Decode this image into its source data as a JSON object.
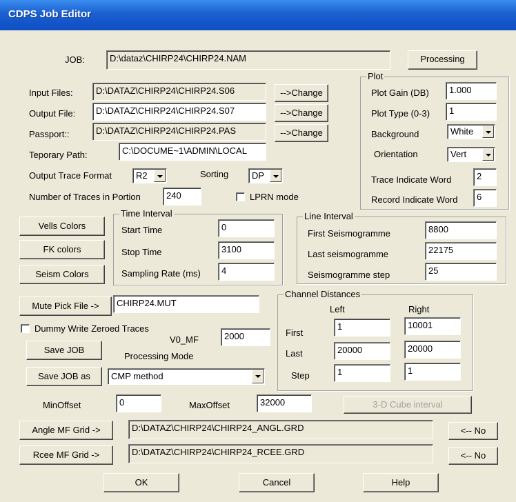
{
  "window": {
    "title": "CDPS Job Editor"
  },
  "job": {
    "label": "JOB:",
    "value": "D:\\dataz\\CHIRP24\\CHIRP24.NAM",
    "processing_button": "Processing"
  },
  "files": {
    "input_label": "Input  Files:",
    "input_value": "D:\\DATAZ\\CHIRP24\\CHIRP24.S06",
    "output_label": "Output  File:",
    "output_value": "D:\\DATAZ\\CHIRP24\\CHIRP24.S07",
    "passport_label": "Passport::",
    "passport_value": "D:\\DATAZ\\CHIRP24\\CHIRP24.PAS",
    "change_label": "-->Change",
    "temp_label": "Teporary Path:",
    "temp_value": "C:\\DOCUME~1\\ADMIN\\LOCAL"
  },
  "format": {
    "trace_label": "Output Trace Format",
    "trace_value": "R2",
    "sorting_label": "Sorting",
    "sorting_value": "DP"
  },
  "portion": {
    "label": "Number of Traces in Portion",
    "value": "240",
    "lprn_label": "LPRN mode"
  },
  "plot": {
    "group_title": "Plot",
    "gain_label": "Plot Gain (DB)",
    "gain_value": "1.000",
    "type_label": "Plot Type (0-3)",
    "type_value": "1",
    "background_label": "Background",
    "background_value": "White",
    "orientation_label": "Orientation",
    "orientation_value": "Vert",
    "trace_word_label": "Trace Indicate Word",
    "trace_word_value": "2",
    "record_word_label": "Record Indicate Word",
    "record_word_value": "6"
  },
  "colors": {
    "vells": "Vells Colors",
    "fk": "FK colors",
    "seism": "Seism Colors"
  },
  "time": {
    "group_title": "Time Interval",
    "start_label": "Start Time",
    "start_value": "0",
    "stop_label": "Stop Time",
    "stop_value": "3100",
    "rate_label": "Sampling Rate (ms)",
    "rate_value": "4"
  },
  "line": {
    "group_title": "Line Interval",
    "first_label": "First Seismogramme",
    "first_value": "8800",
    "last_label": "Last seismogramme",
    "last_value": "22175",
    "step_label": "Seismogramme step",
    "step_value": "25"
  },
  "mute": {
    "button": "Mute Pick File ->",
    "value": "CHIRP24.MUT"
  },
  "dummy": {
    "label": "Dummy Write Zeroed Traces"
  },
  "v0": {
    "label": "V0_MF",
    "value": "2000"
  },
  "save": {
    "job": "Save JOB",
    "job_as": "Save JOB as"
  },
  "mode": {
    "label": "Processing Mode",
    "value": "CMP method"
  },
  "channel": {
    "group_title": "Channel Distances",
    "left_header": "Left",
    "right_header": "Right",
    "first_label": "First",
    "first_left": "1",
    "first_right": "10001",
    "last_label": "Last",
    "last_left": "20000",
    "last_right": "20000",
    "step_label": "Step",
    "step_left": "1",
    "step_right": "1"
  },
  "offset": {
    "min_label": "MinOffset",
    "min_value": "0",
    "max_label": "MaxOffset",
    "max_value": "32000",
    "cube_button": "3-D Cube interval"
  },
  "grids": {
    "angle_button": "Angle MF Grid ->",
    "angle_value": "D:\\DATAZ\\CHIRP24\\CHIRP24_ANGL.GRD",
    "rcee_button": "Rcee MF Grid ->",
    "rcee_value": "D:\\DATAZ\\CHIRP24\\CHIRP24_RCEE.GRD",
    "no_label": "<-- No"
  },
  "footer": {
    "ok": "OK",
    "cancel": "Cancel",
    "help": "Help"
  }
}
